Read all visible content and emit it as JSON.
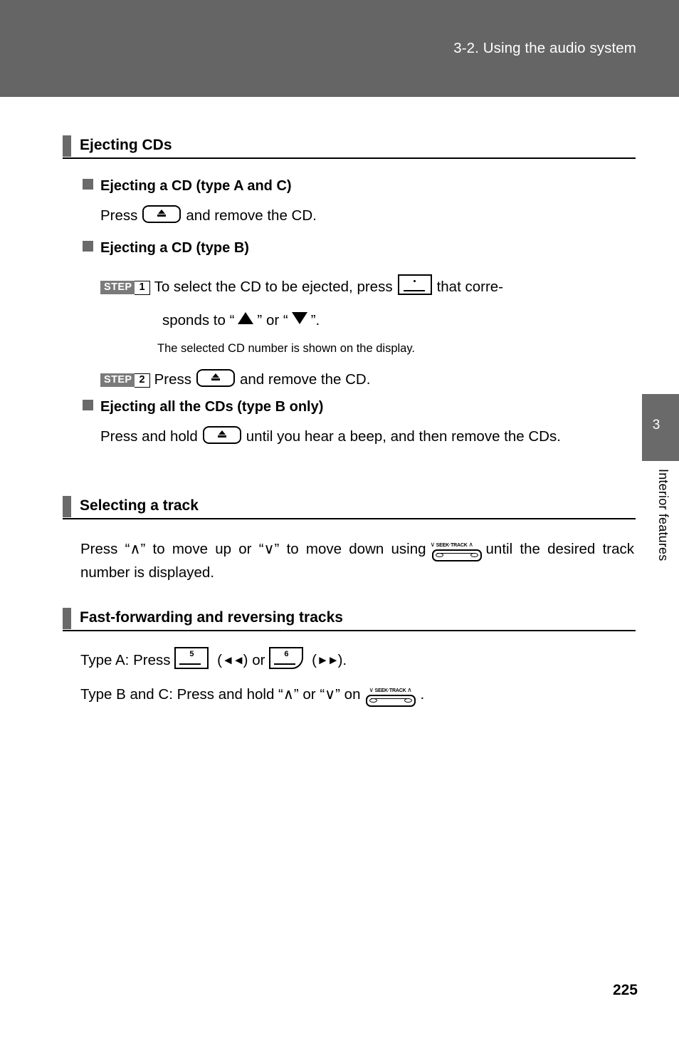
{
  "header": {
    "title": "3-2. Using the audio system"
  },
  "side_tab": {
    "chapter_number": "3",
    "chapter_label": "Interior features"
  },
  "page_number": "225",
  "sections": [
    {
      "id": "ejecting-cds",
      "title": "Ejecting CDs",
      "subsections": [
        {
          "id": "eject-a-c",
          "heading": "Ejecting a CD (type A and C)",
          "text_before": "Press",
          "text_after": "and remove the CD."
        },
        {
          "id": "eject-b",
          "heading": "Ejecting a CD (type B)",
          "step1": {
            "step_label": "STEP",
            "step_number": "1",
            "text_before": "To select the CD to be ejected, press",
            "text_after": "that corre-",
            "line2_before": "sponds to “",
            "line2_middle": "” or “",
            "line2_after": "”.",
            "note": "The selected CD number is shown on the display."
          },
          "step2": {
            "step_label": "STEP",
            "step_number": "2",
            "text_before": "Press",
            "text_after": "and remove the CD."
          }
        },
        {
          "id": "eject-all-b",
          "heading": "Ejecting all the CDs (type B only)",
          "text_before": "Press and hold",
          "text_after": "until you hear a beep, and then remove the CDs."
        }
      ]
    },
    {
      "id": "selecting-a-track",
      "title": "Selecting a track",
      "body_before": "Press “∧” to move up or “∨” to move down using",
      "body_after": "until the desired track number is displayed."
    },
    {
      "id": "fast-forwarding",
      "title": "Fast-forwarding and reversing tracks",
      "line_a": {
        "before": "Type A: Press",
        "middle": ") or",
        "after": ")."
      },
      "line_bc": {
        "before": "Type B and C: Press and hold “∧” or “∨” on",
        "after": "."
      }
    }
  ],
  "icons": {
    "eject_button": "eject-button-icon",
    "cd_select_button": "cd-select-button-icon",
    "seek_track_rocker": "seek-track-rocker-icon",
    "seek_track_caption": "SEEK·TRACK",
    "seek_down_chevron": "∨",
    "seek_up_chevron": "∧",
    "button_5_label": "5",
    "button_6_label": "6",
    "rewind_arrows": "◄◄",
    "forward_arrows": "►►",
    "triangle_up": "▲",
    "triangle_down": "▼"
  },
  "colors": {
    "header_bg": "#656565",
    "tab_gray": "#6a6a6a",
    "step_badge_gray": "#7a7a7a",
    "text": "#000000"
  }
}
